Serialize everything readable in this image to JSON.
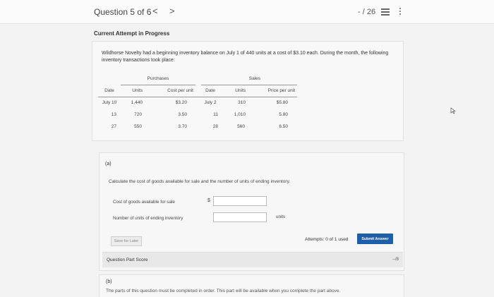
{
  "header": {
    "question_title": "Question 5 of 6",
    "prev_arrow": "<",
    "next_arrow": ">",
    "score": "- / 26",
    "list_icon": "list-icon",
    "more_icon": "kebab-menu-icon"
  },
  "attempt_label": "Current Attempt in Progress",
  "intro": {
    "text": "Wildhorse Novelty had a beginning inventory balance on July 1 of 440 units at a cost of $3.10 each. During the month, the following inventory transactions took place:"
  },
  "inventory_table": {
    "group_headers": {
      "purchases": "Purchases",
      "sales": "Sales"
    },
    "columns": [
      "Date",
      "Units",
      "Cost per unit",
      "Date",
      "Units",
      "Price per unit"
    ],
    "rows": [
      [
        "July 10",
        "1,440",
        "$3.20",
        "July 2",
        "310",
        "$5.80"
      ],
      [
        "13",
        "720",
        "3.50",
        "11",
        "1,010",
        "5.80"
      ],
      [
        "27",
        "550",
        "3.70",
        "28",
        "560",
        "6.50"
      ]
    ]
  },
  "part_a": {
    "label": "(a)",
    "instruction": "Calculate the cost of goods available for sale and the number of units of ending inventory.",
    "fields": [
      {
        "label": "Cost of goods available for sale",
        "prefix": "$",
        "value": "",
        "suffix": ""
      },
      {
        "label": "Number of units of ending inventory",
        "prefix": "",
        "value": "",
        "suffix": "units"
      }
    ],
    "save_label": "Save for Later",
    "attempts_text": "Attempts: 0 of 1 used",
    "submit_label": "Submit Answer",
    "part_score_label": "Question Part Score",
    "part_score_value": "--/8"
  },
  "part_b": {
    "label": "(b)",
    "locked_text": "The parts of this question must be completed in order. This part will be available when you complete the part above."
  },
  "colors": {
    "submit_blue": "#1f5ea8",
    "page_background": "#f3f3f3"
  }
}
